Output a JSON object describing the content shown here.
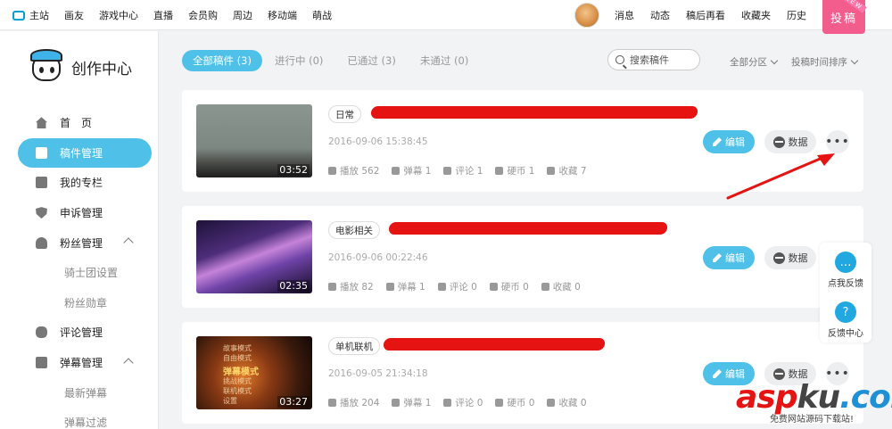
{
  "topnav": {
    "items": [
      "主站",
      "画友",
      "游戏中心",
      "直播",
      "会员购",
      "周边",
      "移动端",
      "萌战"
    ],
    "right_links": [
      "消息",
      "动态",
      "稿后再看",
      "收藏夹",
      "历史"
    ],
    "upload_label": "投稿",
    "upload_badge": "NEW"
  },
  "brand": {
    "title": "创作中心"
  },
  "sidebar": {
    "items": [
      {
        "label": "首　页",
        "icon": "home-icon"
      },
      {
        "label": "稿件管理",
        "icon": "document-icon",
        "active": true
      },
      {
        "label": "我的专栏",
        "icon": "column-icon"
      },
      {
        "label": "申诉管理",
        "icon": "shield-icon"
      },
      {
        "label": "粉丝管理",
        "icon": "fans-icon",
        "expandable": true
      },
      {
        "label": "骑士团设置",
        "sub": true
      },
      {
        "label": "粉丝勋章",
        "sub": true
      },
      {
        "label": "评论管理",
        "icon": "comment-icon"
      },
      {
        "label": "弹幕管理",
        "icon": "danmaku-icon",
        "expandable": true
      },
      {
        "label": "最新弹幕",
        "sub": true
      },
      {
        "label": "弹幕过滤",
        "sub": true
      }
    ]
  },
  "tabs": [
    {
      "label": "全部稿件 (3)",
      "active": true
    },
    {
      "label": "进行中 (0)"
    },
    {
      "label": "已通过 (3)"
    },
    {
      "label": "未通过 (0)"
    }
  ],
  "search": {
    "placeholder": "搜索稿件"
  },
  "filters": {
    "zone": "全部分区",
    "sort": "投稿时间排序"
  },
  "buttons": {
    "edit": "编辑",
    "data": "数据",
    "more": "•••"
  },
  "videos": [
    {
      "tag": "日常",
      "date": "2016-09-06 15:38:45",
      "duration": "03:52",
      "stats": {
        "plays": "播放 562",
        "danmaku": "弹幕 1",
        "comments": "评论 1",
        "coins": "硬币 1",
        "favorites": "收藏 7"
      }
    },
    {
      "tag": "电影相关",
      "date": "2016-09-06 00:22:46",
      "duration": "02:35",
      "stats": {
        "plays": "播放 82",
        "danmaku": "弹幕 1",
        "comments": "评论 0",
        "coins": "硬币 0",
        "favorites": "收藏 0"
      }
    },
    {
      "tag": "单机联机",
      "date": "2016-09-05 21:34:18",
      "duration": "03:27",
      "stats": {
        "plays": "播放 204",
        "danmaku": "弹幕 1",
        "comments": "评论 0",
        "coins": "硬币 0",
        "favorites": "收藏 0"
      },
      "thumb_text": [
        "故事模式",
        "自由模式",
        "弹幕模式",
        "挑战模式",
        "联机模式",
        "设置"
      ]
    }
  ],
  "floating": {
    "feedback": "点我反馈",
    "feedback_center": "反馈中心"
  },
  "watermark": {
    "brand_a": "asp",
    "brand_b": "ku",
    "brand_c": ".com",
    "tagline": "免费网站源码下载站!"
  },
  "colors": {
    "accent": "#4fc1e9",
    "upload": "#f25d8e",
    "redaction": "#e61313"
  }
}
